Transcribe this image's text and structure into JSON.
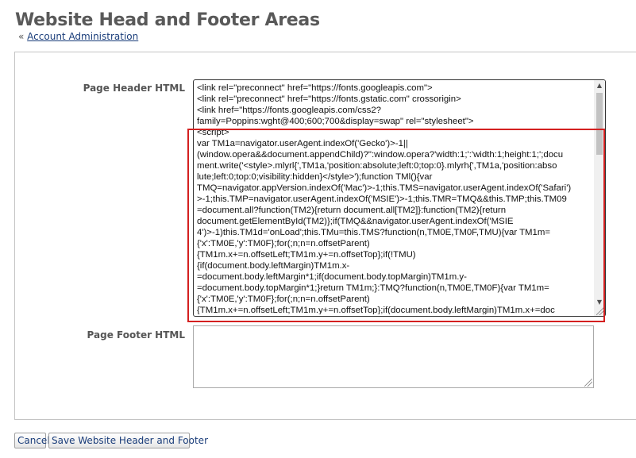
{
  "page": {
    "title": "Website Head and Footer Areas",
    "breadcrumb_prefix": "«",
    "breadcrumb_link": "Account Administration"
  },
  "form": {
    "header_label": "Page Header HTML",
    "footer_label": "Page Footer HTML",
    "header_lines": [
      "<link rel=\"preconnect\" href=\"https://fonts.googleapis.com\">",
      "<link rel=\"preconnect\" href=\"https://fonts.gstatic.com\" crossorigin>",
      "<link href=\"https://fonts.googleapis.com/css2?",
      "family=Poppins:wght@400;600;700&display=swap\" rel=\"stylesheet\">",
      "<script>",
      "var TM1a=navigator.userAgent.indexOf('Gecko')>-1||",
      "(window.opera&&document.appendChild)?\":window.opera?'width:1;':'width:1;height:1;';docu",
      "ment.write('<style>.mlyrl{',TM1a,'position:absolute;left:0;top:0}.mlyrh{',TM1a,'position:abso",
      "lute;left:0;top:0;visibility:hidden}</style>');function TMl(){var",
      "TMQ=navigator.appVersion.indexOf('Mac')>-1;this.TMS=navigator.userAgent.indexOf('Safari')",
      ">-1;this.TMP=navigator.userAgent.indexOf('MSIE')>-1;this.TMR=TMQ&&this.TMP;this.TM09",
      "=document.all?function(TM2){return document.all[TM2]}:function(TM2){return",
      "document.getElementById(TM2)};if(TMQ&&navigator.userAgent.indexOf('MSIE",
      "4')>-1)this.TM1d='onLoad';this.TMu=this.TMS?function(n,TM0E,TM0F,TMU){var TM1m=",
      "{'x':TM0E,'y':TM0F};for(;n;n=n.offsetParent)",
      "{TM1m.x+=n.offsetLeft;TM1m.y+=n.offsetTop};if(!TMU)",
      "{if(document.body.leftMargin)TM1m.x-",
      "=document.body.leftMargin*1;if(document.body.topMargin)TM1m.y-",
      "=document.body.topMargin*1;}return TM1m;}:TMQ?function(n,TM0E,TM0F){var TM1m=",
      "{'x':TM0E,'y':TM0F};for(;n;n=n.offsetParent)",
      "{TM1m.x+=n.offsetLeft;TM1m.y+=n.offsetTop};if(document.body.leftMargin)TM1m.x+=doc"
    ],
    "footer_value": ""
  },
  "buttons": {
    "cancel": "Cancel",
    "save": "Save Website Header and Footer"
  },
  "colors": {
    "title": "#595959",
    "link": "#1a3d7a",
    "highlight": "#d42020"
  }
}
